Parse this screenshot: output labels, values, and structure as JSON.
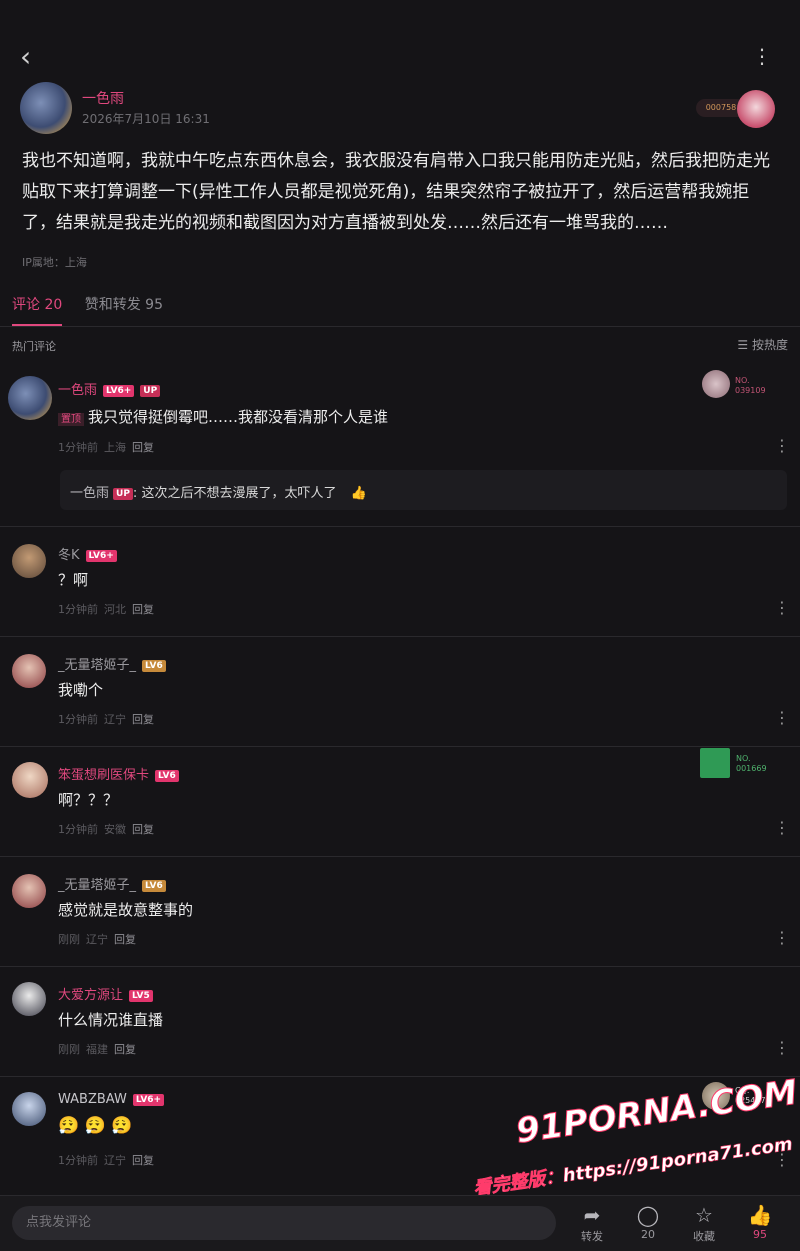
{
  "header": {
    "back_icon": "back-arrow-icon",
    "more_icon": "more-vertical-icon"
  },
  "post": {
    "author": "一色雨",
    "time": "2026年7月10日 16:31",
    "badge_no": "000758",
    "content": "我也不知道啊，我就中午吃点东西休息会，我衣服没有肩带入口我只能用防走光贴，然后我把防走光贴取下来打算调整一下(异性工作人员都是视觉死角)，结果突然帘子被拉开了，然后运营帮我婉拒了，结果就是我走光的视频和截图因为对方直播被到处发……然后还有一堆骂我的……",
    "ip": "IP属地：上海"
  },
  "tabs": [
    {
      "label": "评论 20",
      "active": true
    },
    {
      "label": "赞和转发 95",
      "active": false
    }
  ],
  "section": {
    "title": "热门评论",
    "sort_label": "按热度"
  },
  "comments": [
    {
      "name": "一色雨",
      "level": "LV6+",
      "tag": "UP",
      "pinned": "置顶",
      "text": "我只觉得挺倒霉吧……我都没看清那个人是谁",
      "time": "1分钟前",
      "loc": "上海",
      "reply": "回复",
      "badge": "NO.\n039109",
      "sub_reply": {
        "name": "一色雨",
        "tag": "UP",
        "text": "这次之后不想去漫展了，太吓人了"
      }
    },
    {
      "name": "冬K",
      "level": "LV6+",
      "text": "？啊",
      "time": "1分钟前",
      "loc": "河北",
      "reply": "回复"
    },
    {
      "name": "_无量塔姬子_",
      "level": "LV6",
      "text": "我嘞个",
      "time": "1分钟前",
      "loc": "辽宁",
      "reply": "回复"
    },
    {
      "name": "笨蛋想刷医保卡",
      "level": "LV6",
      "text": "啊？？？",
      "time": "1分钟前",
      "loc": "安徽",
      "reply": "回复",
      "badge": "NO.\n001669"
    },
    {
      "name": "_无量塔姬子_",
      "level": "LV6",
      "text": "感觉就是故意整事的",
      "time": "刚刚",
      "loc": "辽宁",
      "reply": "回复"
    },
    {
      "name": "大爱方源让",
      "level": "LV5",
      "text": "什么情况谁直播",
      "time": "刚刚",
      "loc": "福建",
      "reply": "回复"
    },
    {
      "name": "WABZBAW",
      "level": "LV6+",
      "text": "😮‍💨 😮‍💨 😮‍💨",
      "time": "1分钟前",
      "loc": "辽宁",
      "reply": "回复",
      "badge": "CQ.\n025447"
    }
  ],
  "bottom": {
    "placeholder": "点我发评论",
    "actions": [
      {
        "icon": "share-icon",
        "label": "转发"
      },
      {
        "icon": "comment-icon",
        "label": "20"
      },
      {
        "icon": "star-icon",
        "label": "收藏"
      },
      {
        "icon": "like-icon",
        "label": "95"
      }
    ]
  },
  "watermark": {
    "site": "91PORNA.COM",
    "line2": "看完整版：https://91porna71.com"
  },
  "colors": {
    "accent": "#e0487e",
    "background": "#151417"
  }
}
